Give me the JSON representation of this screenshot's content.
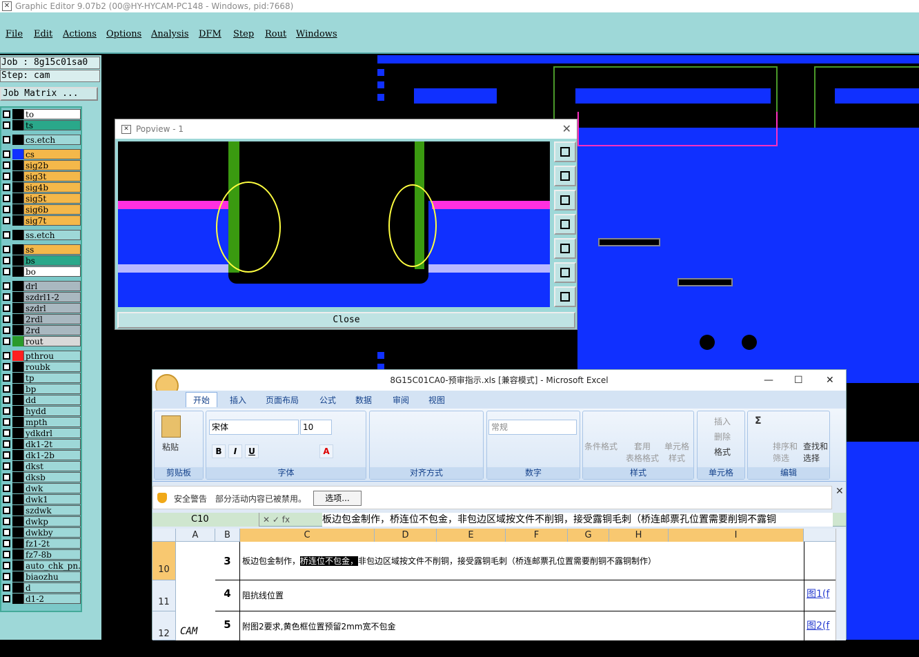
{
  "window": {
    "title": "Graphic Editor 9.07b2 (00@HY-HYCAM-PC148 - Windows, pid:7668)"
  },
  "menu": [
    "File",
    "Edit",
    "Actions",
    "Options",
    "Analysis",
    "DFM",
    "Step",
    "Rout",
    "Windows"
  ],
  "job": {
    "job_line": "Job : 8g15c01sa0",
    "step_line": "Step: cam",
    "matrix_button": "Job Matrix ..."
  },
  "layers": [
    {
      "name": "to",
      "color": "#ffffff",
      "swatch": "#000000"
    },
    {
      "name": "ts",
      "color": "#2aa88a",
      "swatch": "#000000"
    },
    {
      "name": "cs.etch",
      "color": "#9ed8d8",
      "swatch": "#000000"
    },
    {
      "name": "cs",
      "color": "#f4b84a",
      "swatch": "#1030ff"
    },
    {
      "name": "sig2b",
      "color": "#f4b84a",
      "swatch": "#000000"
    },
    {
      "name": "sig3t",
      "color": "#f4b84a",
      "swatch": "#000000"
    },
    {
      "name": "sig4b",
      "color": "#f4b84a",
      "swatch": "#000000"
    },
    {
      "name": "sig5t",
      "color": "#f4b84a",
      "swatch": "#000000"
    },
    {
      "name": "sig6b",
      "color": "#f4b84a",
      "swatch": "#000000"
    },
    {
      "name": "sig7t",
      "color": "#f4b84a",
      "swatch": "#000000"
    },
    {
      "name": "ss.etch",
      "color": "#9ed8d8",
      "swatch": "#000000"
    },
    {
      "name": "ss",
      "color": "#f4b84a",
      "swatch": "#000000"
    },
    {
      "name": "bs",
      "color": "#2aa88a",
      "swatch": "#000000"
    },
    {
      "name": "bo",
      "color": "#ffffff",
      "swatch": "#000000"
    },
    {
      "name": "drl",
      "color": "#a9b8c0",
      "swatch": "#000000"
    },
    {
      "name": "szdrl1-2",
      "color": "#a9b8c0",
      "swatch": "#000000"
    },
    {
      "name": "szdrl",
      "color": "#a9b8c0",
      "swatch": "#000000"
    },
    {
      "name": "2rdl",
      "color": "#a9b8c0",
      "swatch": "#000000"
    },
    {
      "name": "2rd",
      "color": "#a9b8c0",
      "swatch": "#000000"
    },
    {
      "name": "rout",
      "color": "#d9d9d9",
      "swatch": "#2a9a2a"
    },
    {
      "name": "pthrou",
      "color": "#9ed8d8",
      "swatch": "#ff2020"
    },
    {
      "name": "roubk",
      "color": "#9ed8d8",
      "swatch": "#000000"
    },
    {
      "name": "tp",
      "color": "#9ed8d8",
      "swatch": "#000000"
    },
    {
      "name": "bp",
      "color": "#9ed8d8",
      "swatch": "#000000"
    },
    {
      "name": "dd",
      "color": "#9ed8d8",
      "swatch": "#000000"
    },
    {
      "name": "hydd",
      "color": "#9ed8d8",
      "swatch": "#000000"
    },
    {
      "name": "mpth",
      "color": "#9ed8d8",
      "swatch": "#000000"
    },
    {
      "name": "ydkdrl",
      "color": "#9ed8d8",
      "swatch": "#000000"
    },
    {
      "name": "dk1-2t",
      "color": "#9ed8d8",
      "swatch": "#000000"
    },
    {
      "name": "dk1-2b",
      "color": "#9ed8d8",
      "swatch": "#000000"
    },
    {
      "name": "dkst",
      "color": "#9ed8d8",
      "swatch": "#000000"
    },
    {
      "name": "dksb",
      "color": "#9ed8d8",
      "swatch": "#000000"
    },
    {
      "name": "dwk",
      "color": "#9ed8d8",
      "swatch": "#000000"
    },
    {
      "name": "dwk1",
      "color": "#9ed8d8",
      "swatch": "#000000"
    },
    {
      "name": "szdwk",
      "color": "#9ed8d8",
      "swatch": "#000000"
    },
    {
      "name": "dwkp",
      "color": "#9ed8d8",
      "swatch": "#000000"
    },
    {
      "name": "dwkby",
      "color": "#9ed8d8",
      "swatch": "#000000"
    },
    {
      "name": "fz1-2t",
      "color": "#9ed8d8",
      "swatch": "#000000"
    },
    {
      "name": "fz7-8b",
      "color": "#9ed8d8",
      "swatch": "#000000"
    },
    {
      "name": "auto_chk_pn.",
      "color": "#9ed8d8",
      "swatch": "#000000"
    },
    {
      "name": "biaozhu",
      "color": "#9ed8d8",
      "swatch": "#000000"
    },
    {
      "name": "d",
      "color": "#9ed8d8",
      "swatch": "#000000"
    },
    {
      "name": "d1-2",
      "color": "#9ed8d8",
      "swatch": "#000000"
    }
  ],
  "popview": {
    "title": "Popview - 1",
    "close_label": "Close"
  },
  "excel": {
    "title": "8G15C01CA0-预审指示.xls  [兼容模式] - Microsoft Excel",
    "tabs": [
      "开始",
      "插入",
      "页面布局",
      "公式",
      "数据",
      "审阅",
      "视图"
    ],
    "groups": {
      "clipboard": "剪贴板",
      "font": "字体",
      "align": "对齐方式",
      "number": "数字",
      "style": "样式",
      "cells": "单元格",
      "edit": "编辑"
    },
    "paste": "粘贴",
    "font_name": "宋体",
    "font_size": "10",
    "number_format": "常规",
    "style_buttons": [
      "条件格式",
      "套用\n表格格式",
      "单元格\n样式"
    ],
    "cell_buttons": [
      "插入",
      "删除",
      "格式"
    ],
    "edit_buttons": [
      "排序和\n筛选",
      "查找和\n选择"
    ],
    "security": {
      "label": "安全警告",
      "message": "部分活动内容已被禁用。",
      "button": "选项..."
    },
    "name_box": "C10",
    "formula": "板边包金制作，桥连位不包金，非包边区域按文件不削铜，接受露铜毛刺（桥连邮票孔位置需要削铜不露铜",
    "columns": [
      "A",
      "B",
      "C",
      "D",
      "E",
      "F",
      "G",
      "H",
      "I"
    ],
    "rows": [
      {
        "num": "10",
        "b": "3",
        "c_pre": "板边包金制作，",
        "c_hl": "桥连位不包金，",
        "c_post": "非包边区域按文件不削铜，接受露铜毛刺（桥连邮票孔位置需要削铜不露铜制作）",
        "i": ""
      },
      {
        "num": "11",
        "b": "4",
        "c_pre": "阻抗线位置",
        "c_hl": "",
        "c_post": "",
        "i": "图1(f"
      },
      {
        "num": "12",
        "a": "CAM",
        "b": "5",
        "c_pre": "附图2要求,黄色框位置预留2mm宽不包金",
        "c_hl": "",
        "c_post": "",
        "i": "图2(f"
      }
    ]
  }
}
